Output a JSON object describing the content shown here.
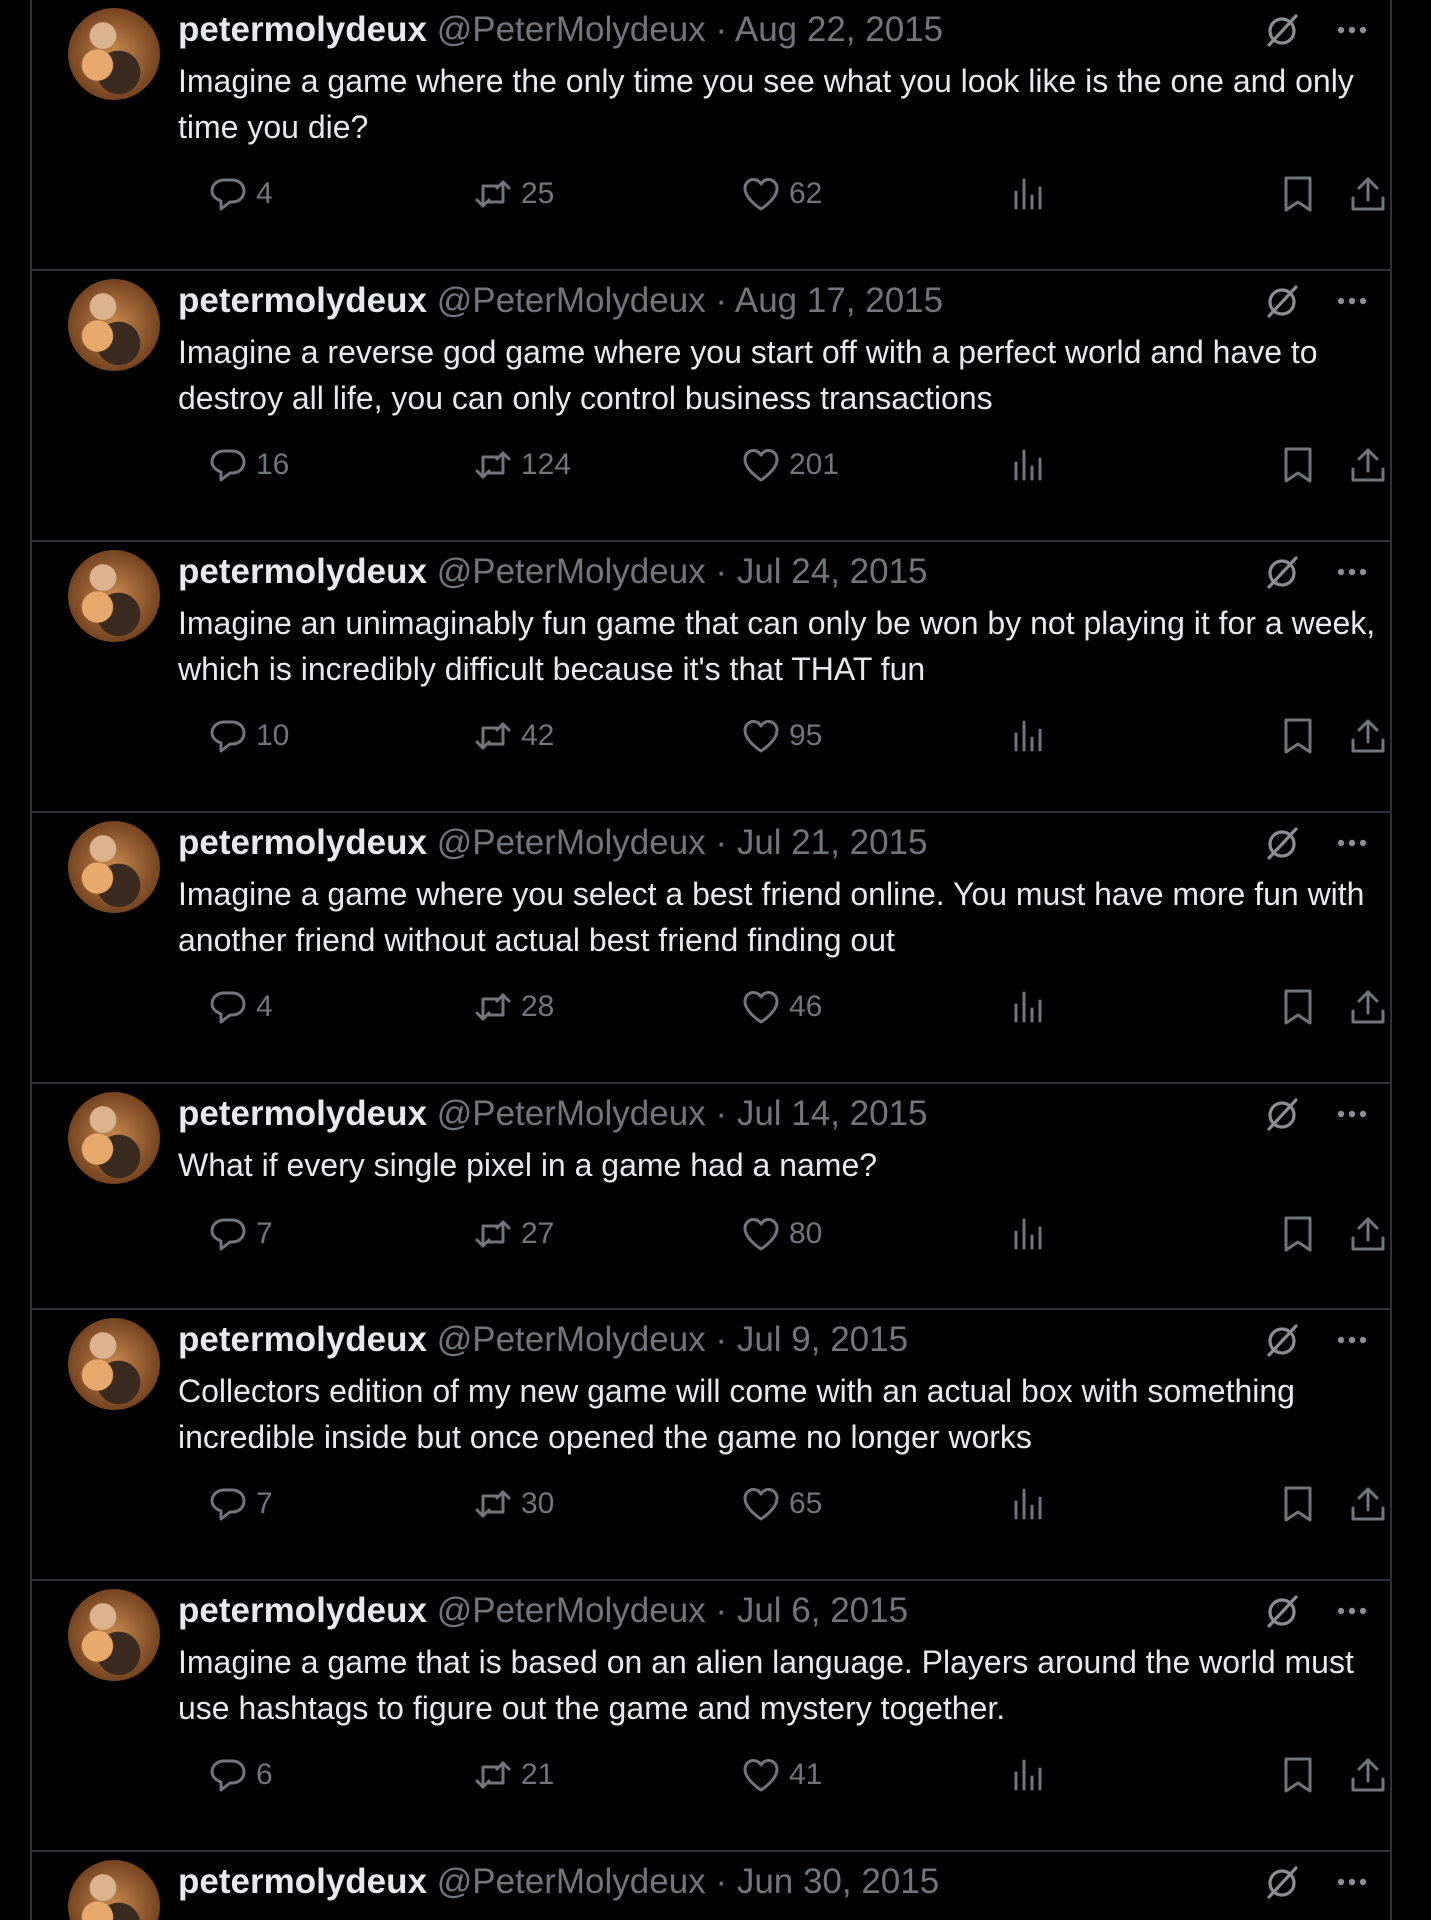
{
  "tweets": [
    {
      "name": "petermolydeux",
      "handle": "@PeterMolydeux",
      "dot": "·",
      "date": "Aug 22, 2015",
      "text": "Imagine a game where the only time you see what you look like is the one and only time you die?",
      "replies": "4",
      "retweets": "25",
      "likes": "62"
    },
    {
      "name": "petermolydeux",
      "handle": "@PeterMolydeux",
      "dot": "·",
      "date": "Aug 17, 2015",
      "text": "Imagine a reverse god game where you start off with a perfect world and have to destroy all life, you can only control business transactions",
      "replies": "16",
      "retweets": "124",
      "likes": "201"
    },
    {
      "name": "petermolydeux",
      "handle": "@PeterMolydeux",
      "dot": "·",
      "date": "Jul 24, 2015",
      "text": "Imagine an unimaginably fun game that can only be won by not playing it for a week, which is incredibly difficult because it's that THAT fun",
      "replies": "10",
      "retweets": "42",
      "likes": "95"
    },
    {
      "name": "petermolydeux",
      "handle": "@PeterMolydeux",
      "dot": "·",
      "date": "Jul 21, 2015",
      "text": "Imagine a game where you select a best friend online. You must have more fun with another friend without actual best friend finding out",
      "replies": "4",
      "retweets": "28",
      "likes": "46"
    },
    {
      "name": "petermolydeux",
      "handle": "@PeterMolydeux",
      "dot": "·",
      "date": "Jul 14, 2015",
      "text": "What if every single pixel in a game had a name?",
      "replies": "7",
      "retweets": "27",
      "likes": "80"
    },
    {
      "name": "petermolydeux",
      "handle": "@PeterMolydeux",
      "dot": "·",
      "date": "Jul 9, 2015",
      "text": "Collectors edition of my new game will come with an actual box with something incredible inside but once opened the game no longer works",
      "replies": "7",
      "retweets": "30",
      "likes": "65"
    },
    {
      "name": "petermolydeux",
      "handle": "@PeterMolydeux",
      "dot": "·",
      "date": "Jul 6, 2015",
      "text": "Imagine a game that is based on an alien language. Players around the world must use hashtags to figure out the game and mystery together.",
      "replies": "6",
      "retweets": "21",
      "likes": "41"
    },
    {
      "name": "petermolydeux",
      "handle": "@PeterMolydeux",
      "dot": "·",
      "date": "Jun 30, 2015"
    }
  ],
  "icons": {
    "grok": "grok-icon",
    "more": "more-options-icon",
    "reply": "reply-icon",
    "retweet": "retweet-icon",
    "like": "like-icon",
    "views": "views-icon",
    "bookmark": "bookmark-icon",
    "share": "share-icon"
  },
  "colors": {
    "background": "#000000",
    "text": "#e7e9ea",
    "secondary": "#71767b",
    "divider": "#2f3336"
  }
}
